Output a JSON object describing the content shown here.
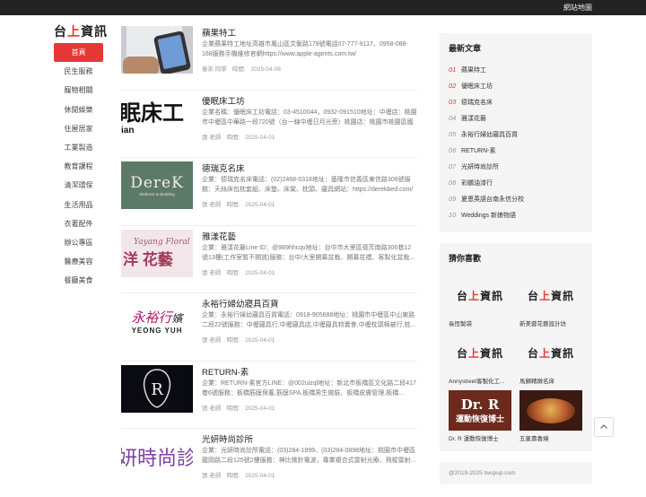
{
  "topbar": {
    "sitemap": "網站地圖"
  },
  "logo": {
    "part1": "台",
    "part2": "上",
    "part3": "資訊"
  },
  "nav": [
    "首頁",
    "民生服務",
    "寵物相關",
    "休閒娛樂",
    "住屋居家",
    "工業製造",
    "教育課程",
    "清潔環保",
    "生活用品",
    "衣著配件",
    "辦公專區",
    "醫療美容",
    "餐廳美食"
  ],
  "posts": [
    {
      "title": "蘋果特工",
      "excerpt": "企業蘋果特工地址高雄市鳳山區文衡路178號電話07-777-9117、0958-088-168服務手機維修官網https://www.apple-agents.com.tw/",
      "author": "泰來 同學",
      "time_label": "時間:",
      "date": "2025-04-08"
    },
    {
      "title": "優眠床工坊",
      "excerpt": "企業名稱：優眠床工坊電話：03-4510044，0932-091510地址：中壢店：桃園市中壢區中華路一段720號（台一線中壢日月光旁）桃園店：桃園市桃園區國際...",
      "author": "張 老師",
      "time_label": "時間:",
      "date": "2025-04-01"
    },
    {
      "title": "德瑞克名床",
      "excerpt": "企業：德瑞克名床電話：(02)2468-0318地址：基隆市信義區東信路306號服務：天絲床包枕套組、床墊、床架、枕頭、寢具網站：https://derekbed.com/",
      "author": "張 老師",
      "time_label": "時間:",
      "date": "2025-04-01"
    },
    {
      "title": "雅漾花藝",
      "excerpt": "企業：雅漾花藝Line ID：@989hhcqv地址：台中市大里區德芳南路306巷12號13樓(工作室暫不開放)服務：台中/大里開幕盆栽、開幕花禮、客製化盆栽...",
      "author": "張 老師",
      "time_label": "時間:",
      "date": "2025-04-01"
    },
    {
      "title": "永裕行婦幼寢具百貨",
      "excerpt": "企業：永裕行婦幼寢具百貨電話：0918-905688地址：桃園市中壢區中山東路二段22號服務：中壢寢具行,中壢寢具店,中壢寢具特賣會,中壢枕頭棉被行,枕...",
      "author": "張 老師",
      "time_label": "時間:",
      "date": "2025-04-01"
    },
    {
      "title": "RETURN-素",
      "excerpt": "企業：RETURN-素官方LINE：@002uizql地址：新北市板橋區文化路二段417巷6號服務：板橋筋膜保養,筋膜SPA,板橋男生做臉、板橋皮膚管理,板橋...",
      "author": "張 老師",
      "time_label": "時間:",
      "date": "2025-04-01"
    },
    {
      "title": "光妍時尚診所",
      "excerpt": "企業：光妍時尚診所電話：(03)284-1999、(03)284-0898地址：桃園市中壢區龍岡路二段125號2樓服務：神比微針電波，專業複合式雷射光療、飛梭雷射...",
      "author": "張 老師",
      "time_label": "時間:",
      "date": "2025-04-01"
    }
  ],
  "thumbs": {
    "p2": "眠床工",
    "p2sub": "ian",
    "p3": "DereK",
    "p3sub": "Mattress & Bedding",
    "p4": "Yayang Floral",
    "p4cn": "洋 花藝",
    "p5": "永裕行",
    "p5tail": "嬪",
    "p5en": "YEONG YUH",
    "p7": "妍時尚診"
  },
  "latest": {
    "heading": "最新文章",
    "items": [
      {
        "num": "01",
        "title": "蘋果特工"
      },
      {
        "num": "02",
        "title": "優眠床工坊"
      },
      {
        "num": "03",
        "title": "德瑞克名床"
      },
      {
        "num": "04",
        "title": "雅漾花藝"
      },
      {
        "num": "05",
        "title": "永裕行婦幼寢具百貨"
      },
      {
        "num": "06",
        "title": "RETURN-素"
      },
      {
        "num": "07",
        "title": "光妍時尚診所"
      },
      {
        "num": "08",
        "title": "彩鵬油漆行"
      },
      {
        "num": "09",
        "title": "夏恩英語台南永信分校"
      },
      {
        "num": "10",
        "title": "Weddings 新娘物語"
      }
    ]
  },
  "guess": {
    "heading": "猜你喜歡",
    "items": [
      {
        "caption": "長恆製袋"
      },
      {
        "caption": "新美蓉花藝設計坊"
      },
      {
        "caption": "Annystreet客製化工..."
      },
      {
        "caption": "馬歸精緻名床"
      },
      {
        "caption": "Dr. R 運動恢復博士",
        "img_title": "Dr. R",
        "img_sub": "運動恢復博士"
      },
      {
        "caption": "五稟壽喜燒"
      }
    ]
  },
  "footer": {
    "copyright": "@2019-2025 twupup.com"
  },
  "colors": {
    "accent": "#e53935",
    "topbar": "#222222",
    "sidebar_bg": "#f5f5f5"
  }
}
